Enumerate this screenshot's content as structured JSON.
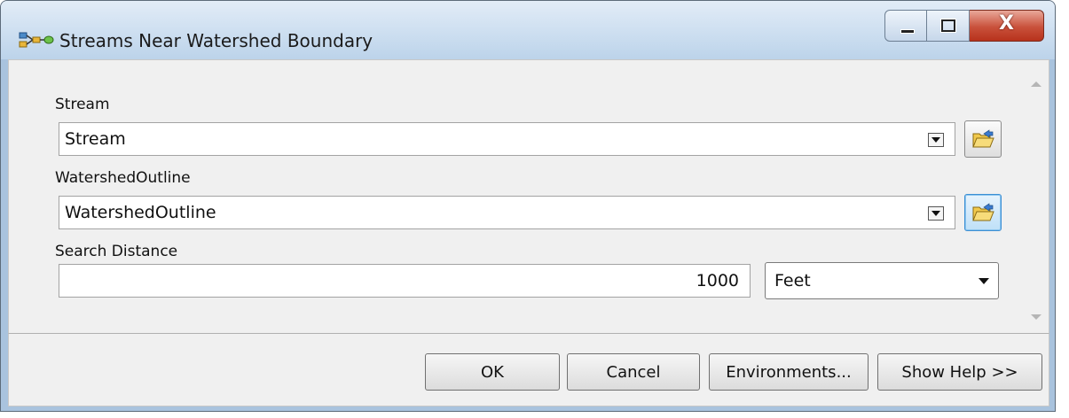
{
  "window": {
    "title": "Streams Near Watershed Boundary",
    "close_glyph": "X"
  },
  "params": {
    "stream": {
      "label": "Stream",
      "value": "Stream"
    },
    "watershed": {
      "label": "WatershedOutline",
      "value": "WatershedOutline"
    },
    "search_distance": {
      "label": "Search Distance",
      "value": "1000",
      "units": "Feet"
    }
  },
  "buttons": {
    "ok": "OK",
    "cancel": "Cancel",
    "environments": "Environments...",
    "show_help": "Show Help >>"
  },
  "icons": {
    "app": "model-tool-icon",
    "browse": "open-folder-icon",
    "minimize": "minimize-icon",
    "maximize": "maximize-icon",
    "close": "close-icon"
  },
  "colors": {
    "titlebar": "#cfe0f1",
    "close_button": "#c9513b",
    "panel": "#f0f0f0"
  }
}
